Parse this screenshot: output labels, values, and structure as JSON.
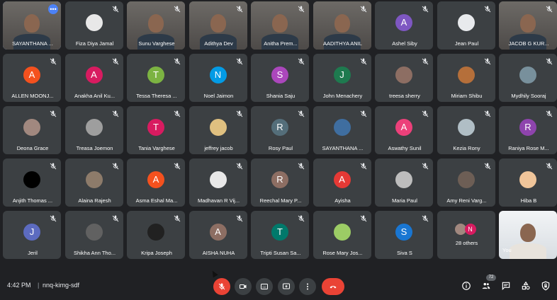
{
  "participants": [
    {
      "name": "SAYANTHANA ...",
      "kind": "video",
      "self": true,
      "more": true
    },
    {
      "name": "Fiza Diya Jamal",
      "kind": "avatar",
      "photo": true,
      "color": "#e8e8e8",
      "muted": true
    },
    {
      "name": "Sunu Varghese",
      "kind": "video",
      "muted": true
    },
    {
      "name": "Adithya Dev",
      "kind": "video",
      "muted": true
    },
    {
      "name": "Anitha Prem...",
      "kind": "video",
      "muted": true
    },
    {
      "name": "AADITHYA ANIL",
      "kind": "video",
      "muted": true
    },
    {
      "name": "Ashel Siby",
      "kind": "avatar",
      "initial": "A",
      "color": "#7e57c2",
      "muted": true
    },
    {
      "name": "Jean Paul",
      "kind": "avatar",
      "photo": true,
      "color": "#e8eaed",
      "muted": true
    },
    {
      "name": "JACOB G KUR...",
      "kind": "video",
      "muted": true
    },
    {
      "name": "ALLEN MOONJ...",
      "kind": "avatar",
      "initial": "A",
      "color": "#f4511e",
      "muted": true
    },
    {
      "name": "Anakha Anil Ku...",
      "kind": "avatar",
      "initial": "A",
      "color": "#d81b60",
      "muted": true
    },
    {
      "name": "Tessa Theresa ...",
      "kind": "avatar",
      "initial": "T",
      "color": "#7cb342",
      "muted": true
    },
    {
      "name": "Noel Jaimon",
      "kind": "avatar",
      "initial": "N",
      "color": "#039be5",
      "muted": true
    },
    {
      "name": "Shania Saju",
      "kind": "avatar",
      "initial": "S",
      "color": "#ab47bc",
      "muted": true
    },
    {
      "name": "John Menachery",
      "kind": "avatar",
      "initial": "J",
      "color": "#1e7a4f",
      "muted": true
    },
    {
      "name": "treesa sherry",
      "kind": "avatar",
      "photo": true,
      "color": "#8d6e63",
      "muted": true
    },
    {
      "name": "Miriam Shibu",
      "kind": "avatar",
      "photo": true,
      "color": "#b56f3a",
      "muted": true
    },
    {
      "name": "Mydhily Sooraj",
      "kind": "avatar",
      "photo": true,
      "color": "#78909c",
      "muted": true
    },
    {
      "name": "Deona Grace",
      "kind": "avatar",
      "photo": true,
      "color": "#a1887f",
      "muted": true
    },
    {
      "name": "Treasa Joemon",
      "kind": "avatar",
      "photo": true,
      "color": "#9e9e9e",
      "muted": true
    },
    {
      "name": "Tania Varghese",
      "kind": "avatar",
      "initial": "T",
      "color": "#d81b60",
      "muted": true
    },
    {
      "name": "jeffrey jacob",
      "kind": "avatar",
      "photo": true,
      "color": "#e0c080",
      "muted": true
    },
    {
      "name": "Rosy Paul",
      "kind": "avatar",
      "initial": "R",
      "color": "#546e7a",
      "muted": true
    },
    {
      "name": "SAYANTHANA ...",
      "kind": "avatar",
      "photo": true,
      "color": "#3f6ea0",
      "muted": true
    },
    {
      "name": "Aswathy Sunil",
      "kind": "avatar",
      "initial": "A",
      "color": "#ec407a",
      "muted": true
    },
    {
      "name": "Kezia Rony",
      "kind": "avatar",
      "photo": true,
      "color": "#b0bec5",
      "muted": true
    },
    {
      "name": "Raniya Rose M...",
      "kind": "avatar",
      "initial": "R",
      "color": "#8e44ad",
      "muted": true
    },
    {
      "name": "Anjith Thomas ...",
      "kind": "avatar",
      "photo": true,
      "color": "#000000",
      "muted": true
    },
    {
      "name": "Alaina Rajesh",
      "kind": "avatar",
      "photo": true,
      "color": "#8d7b6a",
      "muted": true
    },
    {
      "name": "Asma Eshal Ma...",
      "kind": "avatar",
      "initial": "A",
      "color": "#f4511e",
      "muted": true
    },
    {
      "name": "Madhavan R Vij...",
      "kind": "avatar",
      "photo": true,
      "color": "#e8e8e8",
      "muted": true
    },
    {
      "name": "Reechal Mary P...",
      "kind": "avatar",
      "initial": "R",
      "color": "#8d6e63",
      "muted": true
    },
    {
      "name": "Ayisha",
      "kind": "avatar",
      "initial": "A",
      "color": "#e53935",
      "muted": true
    },
    {
      "name": "Maria Paul",
      "kind": "avatar",
      "photo": true,
      "color": "#bdbdbd",
      "muted": true
    },
    {
      "name": "Amy Reni Varg...",
      "kind": "avatar",
      "photo": true,
      "color": "#6d5e55",
      "muted": true
    },
    {
      "name": "Hiba B",
      "kind": "avatar",
      "photo": true,
      "color": "#f0c59a",
      "muted": true
    },
    {
      "name": "Jeril",
      "kind": "avatar",
      "initial": "J",
      "color": "#5c6bc0",
      "muted": true
    },
    {
      "name": "Shikha Ann Tho...",
      "kind": "avatar",
      "photo": true,
      "color": "#616161",
      "muted": true
    },
    {
      "name": "Kripa Joseph",
      "kind": "avatar",
      "photo": true,
      "color": "#212121",
      "muted": true
    },
    {
      "name": "AISHA NUHA",
      "kind": "avatar",
      "initial": "A",
      "color": "#8d6e63",
      "muted": true
    },
    {
      "name": "Tripti Susan Sa...",
      "kind": "avatar",
      "initial": "T",
      "color": "#00796b",
      "muted": true
    },
    {
      "name": "Rose Mary Jos...",
      "kind": "avatar",
      "photo": true,
      "color": "#9ccc65",
      "muted": true
    },
    {
      "name": "Siva S",
      "kind": "avatar",
      "initial": "S",
      "color": "#1976d2",
      "muted": true
    },
    {
      "name": "28 others",
      "kind": "others",
      "initial": "N",
      "color": "#d81b60"
    },
    {
      "name": "You",
      "kind": "video",
      "self_preview": true
    }
  ],
  "bottom_bar": {
    "time": "4:42 PM",
    "separator": "|",
    "meeting_code": "nnq-kimg-sdf",
    "people_count": "72"
  }
}
